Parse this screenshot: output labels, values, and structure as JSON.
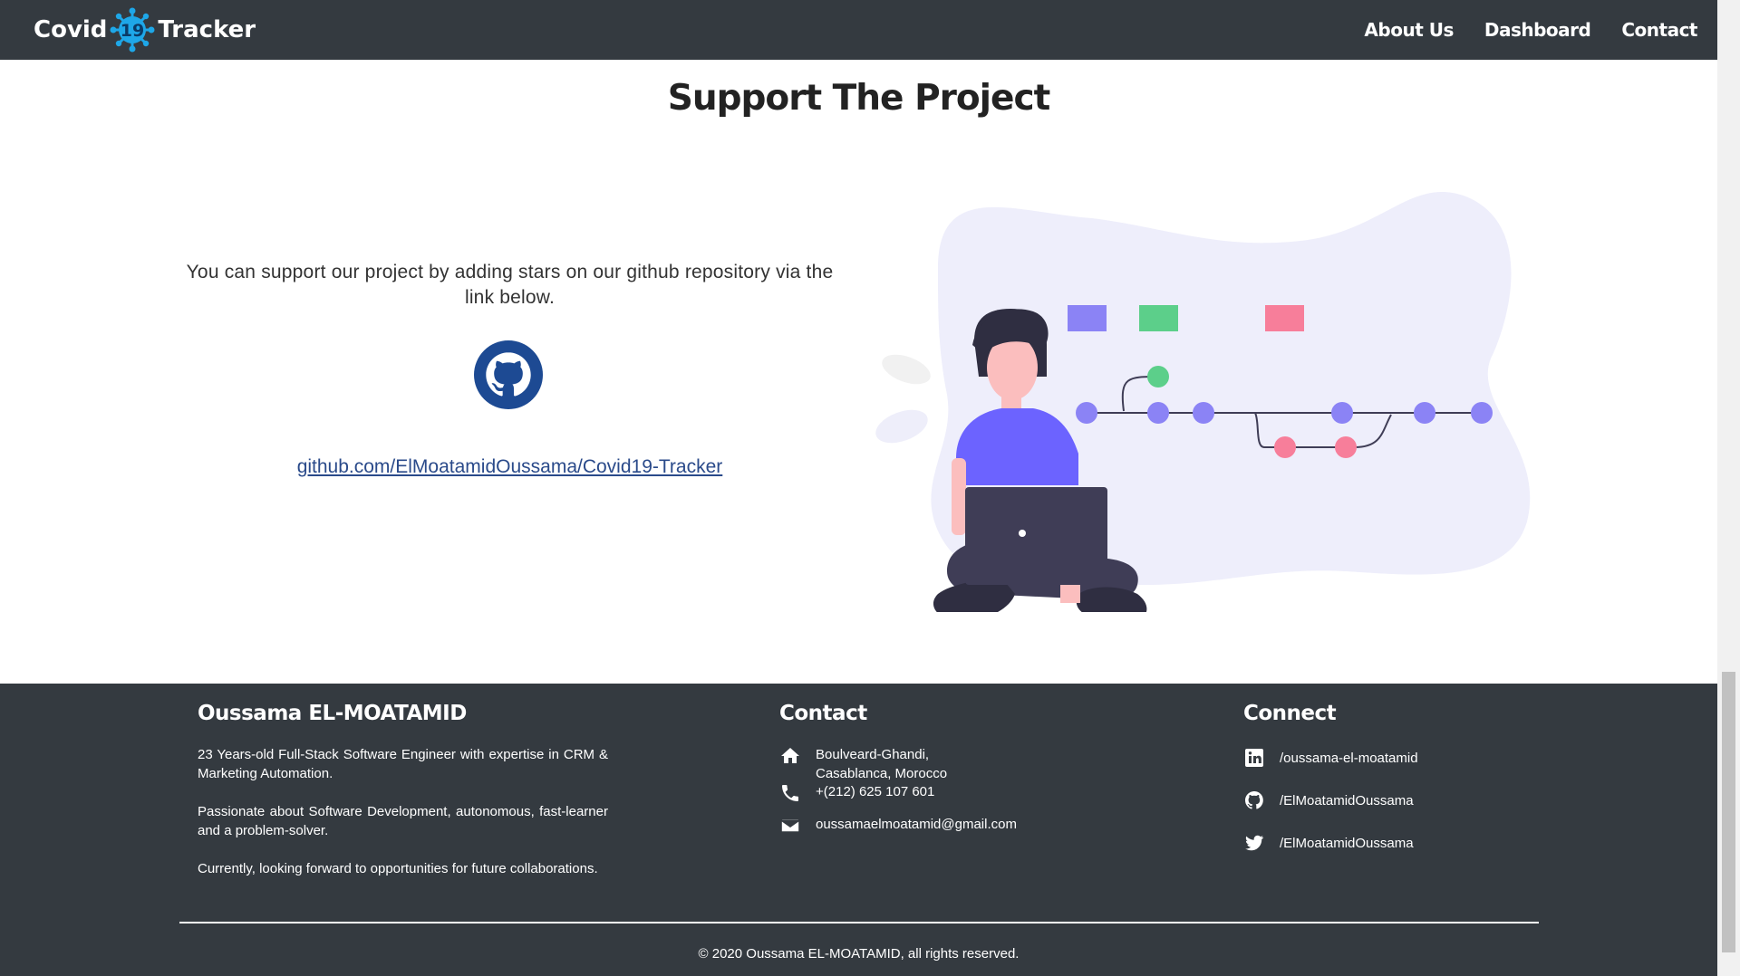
{
  "nav": {
    "brand_left": "Covid",
    "brand_badge": "19",
    "brand_right": "Tracker",
    "links": [
      "About Us",
      "Dashboard",
      "Contact"
    ]
  },
  "main": {
    "title": "Support The Project",
    "description": "You can support our project by adding stars on our github repository via the link below.",
    "repo_link": "github.com/ElMoatamidOussama/Covid19-Tracker"
  },
  "footer": {
    "about": {
      "heading": "Oussama EL-MOATAMID",
      "p1": "23 Years-old Full-Stack Software Engineer with expertise in CRM & Marketing Automation.",
      "p2": "Passionate about Software Development, autonomous, fast-learner and a problem-solver.",
      "p3": "Currently, looking forward to opportunities for future collaborations."
    },
    "contact": {
      "heading": "Contact",
      "address_line1": "Boulveard-Ghandi,",
      "address_line2": "Casablanca, Morocco",
      "phone": "+(212) 625 107 601",
      "email": "oussamaelmoatamid@gmail.com"
    },
    "connect": {
      "heading": "Connect",
      "linkedin": "/oussama-el-moatamid",
      "github": "/ElMoatamidOussama",
      "twitter": "/ElMoatamidOussama"
    },
    "copyright": "© 2020 Oussama EL-MOATAMID, all rights reserved."
  },
  "colors": {
    "navbar": "#343a40",
    "accent_purple": "#8b83f5",
    "accent_green": "#5ccf8a",
    "accent_pink": "#f77e9a",
    "github_blue": "#1d4a93"
  },
  "icons": [
    "virus-icon",
    "github-icon",
    "home-icon",
    "phone-icon",
    "mail-icon",
    "linkedin-icon",
    "twitter-icon"
  ]
}
